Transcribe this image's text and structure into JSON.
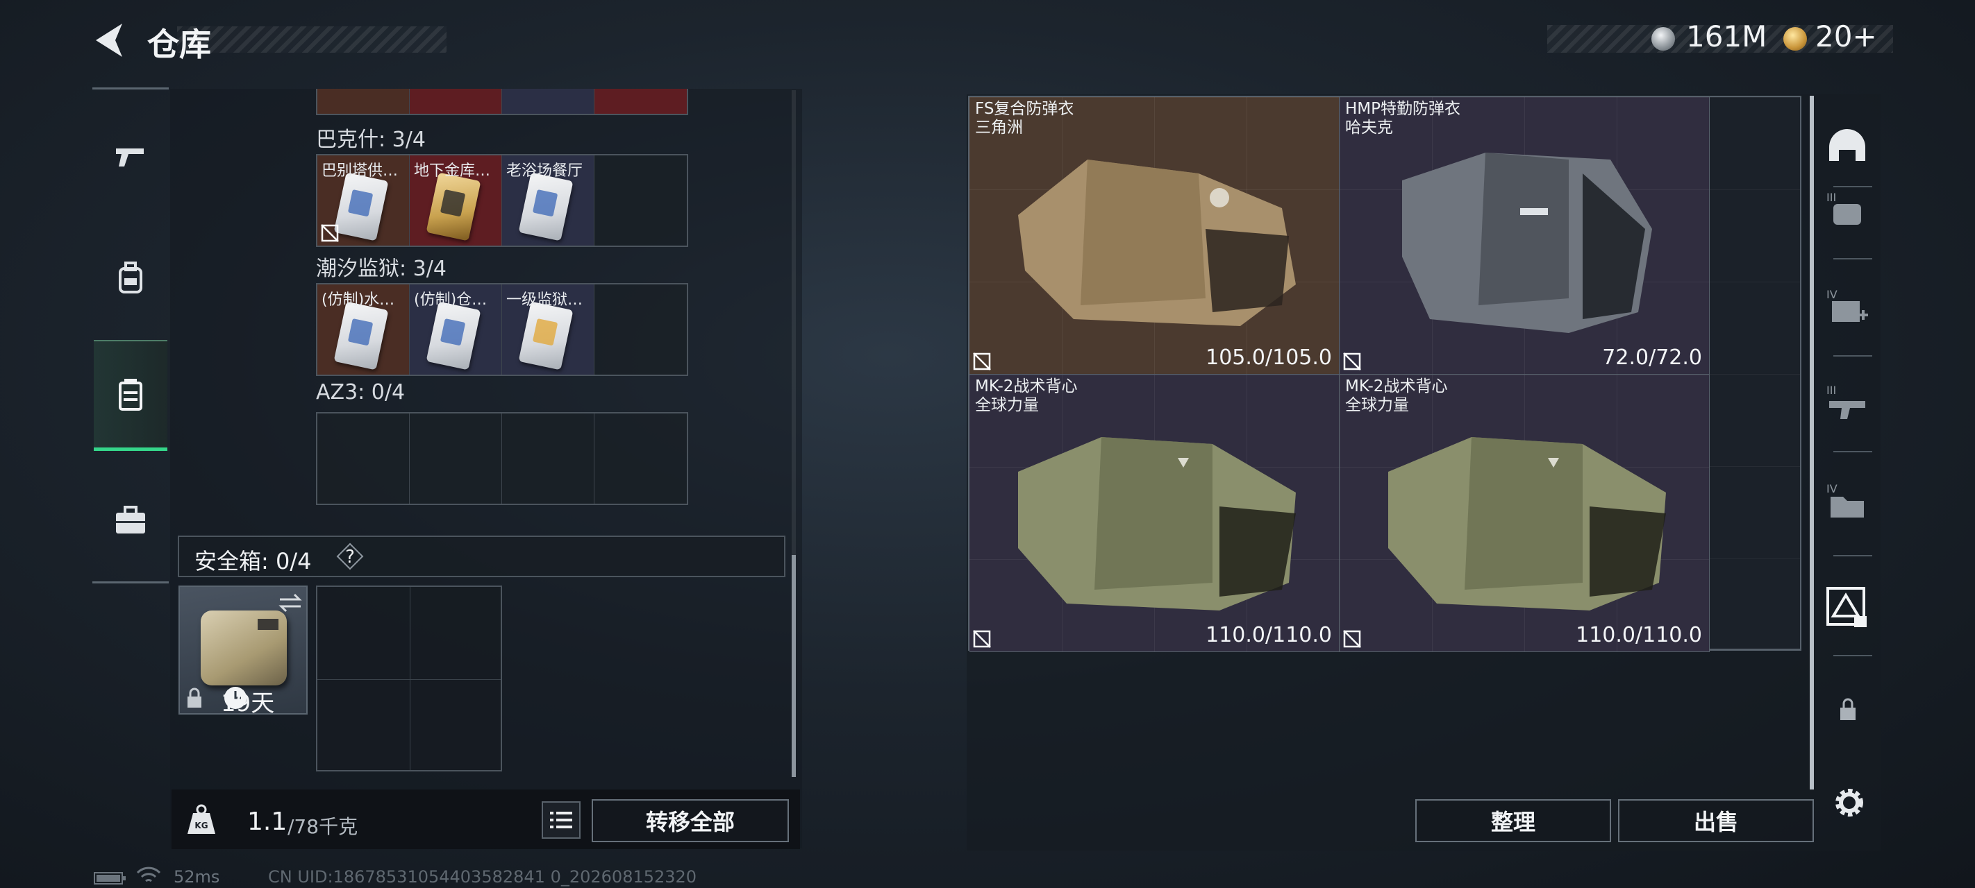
{
  "header": {
    "title": "仓库",
    "currency_silver": "161M",
    "currency_gold": "20+"
  },
  "left_tabs": [
    {
      "icon": "pistol-icon"
    },
    {
      "icon": "backpack-icon"
    },
    {
      "icon": "storage-case-icon",
      "active": true
    },
    {
      "icon": "briefcase-icon"
    }
  ],
  "key_sections": [
    {
      "label": "巴克什: 3/4",
      "cells": [
        "巴别塔供…",
        "地下金库…",
        "老浴场餐厅",
        ""
      ]
    },
    {
      "label": "潮汐监狱: 3/4",
      "cells": [
        "(仿制)水…",
        "(仿制)仓…",
        "一级监狱…",
        ""
      ]
    },
    {
      "label": "AZ3: 0/4",
      "cells": [
        "",
        "",
        "",
        ""
      ]
    }
  ],
  "safe_box": {
    "label": "安全箱: 0/4",
    "help": "?",
    "days": "19天"
  },
  "bottom": {
    "weight_current": "1.1",
    "weight_max": "/78千克",
    "transfer_all": "转移全部"
  },
  "armor_items": [
    {
      "name": "FS复合防弹衣",
      "maker": "三角洲",
      "durability": "105.0/105.0",
      "bg": "brown"
    },
    {
      "name": "HMP特勤防弹衣",
      "maker": "哈夫克",
      "durability": "72.0/72.0",
      "bg": "purple"
    },
    {
      "name": "MK-2战术背心",
      "maker": "全球力量",
      "durability": "110.0/110.0",
      "bg": "purple"
    },
    {
      "name": "MK-2战术背心",
      "maker": "全球力量",
      "durability": "110.0/110.0",
      "bg": "purple"
    }
  ],
  "right_actions": {
    "organize": "整理",
    "sell": "出售"
  },
  "right_rail": [
    "helmet-filter-icon",
    "tier3-armor-filter-icon",
    "tier4-medkit-filter-icon",
    "tier3-weapon-filter-icon",
    "tier4-folder-filter-icon",
    "storage-lock-icon",
    "lock-icon",
    "settings-gear-icon"
  ],
  "status": {
    "ping": "52ms",
    "uid": "CN UID:18678531054403582841 0_202608152320"
  }
}
